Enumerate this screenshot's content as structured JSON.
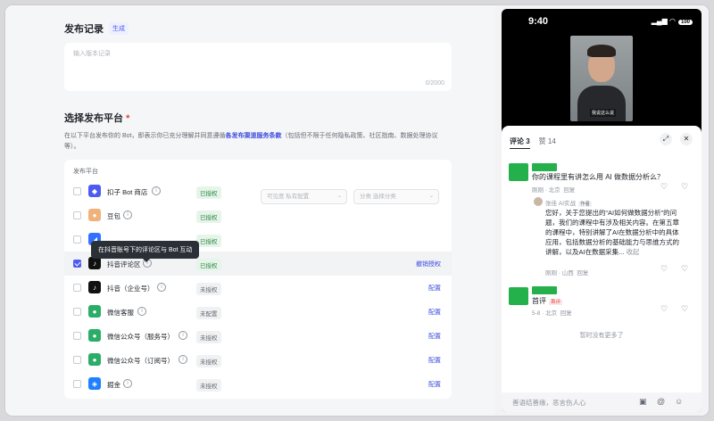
{
  "publish": {
    "notes_title": "发布记录",
    "generate_label": "生成",
    "notes_placeholder": "输入版本记录",
    "notes_counter": "0/2000",
    "platform_title": "选择发布平台",
    "required_mark": "*",
    "desc_prefix": "在以下平台发布你的 Bot，即表示你已充分理解并同意遵循",
    "desc_link": "各发布渠道服务条款",
    "desc_suffix": "（包括但不限于任何隐私政策、社区指南、数据处理协议等）。",
    "table_header": "发布平台",
    "visibility_select": "可见度  私有配置",
    "category_select": "分类  选择分类",
    "tooltip": "在抖音账号下的评论区与 Bot 互动",
    "rows": [
      {
        "name": "扣子 Bot 商店",
        "status": "已授权",
        "status_type": "ok",
        "action": "",
        "checked": false,
        "icon": "coze-store-icon",
        "icon_color": "#4e5bf2",
        "icon_glyph": "◆"
      },
      {
        "name": "豆包",
        "status": "已授权",
        "status_type": "ok",
        "action": "",
        "checked": false,
        "icon": "doubao-icon",
        "icon_color": "#f0b27a",
        "icon_glyph": "●"
      },
      {
        "name": "",
        "status": "已授权",
        "status_type": "ok",
        "action": "",
        "checked": false,
        "icon": "feishu-icon",
        "icon_color": "#3370ff",
        "icon_glyph": "◢"
      },
      {
        "name": "抖音评论区",
        "status": "已授权",
        "status_type": "ok",
        "action": "撤销授权",
        "checked": true,
        "icon": "douyin-icon",
        "icon_color": "#111111",
        "icon_glyph": "♪"
      },
      {
        "name": "抖音（企业号）",
        "status": "未授权",
        "status_type": "no",
        "action": "配置",
        "checked": false,
        "icon": "douyin-icon",
        "icon_color": "#111111",
        "icon_glyph": "♪"
      },
      {
        "name": "微信客服",
        "status": "未配置",
        "status_type": "no",
        "action": "配置",
        "checked": false,
        "icon": "wechat-icon",
        "icon_color": "#2aae67",
        "icon_glyph": "●"
      },
      {
        "name": "微信公众号（服务号）",
        "status": "未授权",
        "status_type": "no",
        "action": "配置",
        "checked": false,
        "icon": "wechat-icon",
        "icon_color": "#2aae67",
        "icon_glyph": "●"
      },
      {
        "name": "微信公众号（订阅号）",
        "status": "未授权",
        "status_type": "no",
        "action": "配置",
        "checked": false,
        "icon": "wechat-icon",
        "icon_color": "#2aae67",
        "icon_glyph": "●"
      },
      {
        "name": "掘金",
        "status": "未授权",
        "status_type": "no",
        "action": "配置",
        "checked": false,
        "icon": "juejin-icon",
        "icon_color": "#1e80ff",
        "icon_glyph": "◈"
      }
    ]
  },
  "phone": {
    "time": "9:40",
    "battery": "100",
    "video_caption": "我说这么说",
    "comments_tab": "评论 3",
    "likes_tab": "赞 14",
    "comment1_text": "你的课程里有讲怎么用 AI 做数据分析么？",
    "comment1_meta": "刚刚 · 北京",
    "reply_label": "回复",
    "reply_author": "张佳 AI实战",
    "author_tag": "作者",
    "reply_text": "您好，关于您提出的“AI如何做数据分析”的问题，我们的课程中有涉及相关内容。在第五章的课程中，特别讲解了AI在数据分析中的具体应用，包括数据分析的基础能力与思维方式的讲解，以及AI在数据采集...",
    "reply_more": "收起",
    "reply_meta": "刚刚 · 山西",
    "comment2_text": "首评",
    "first_tag": "首评",
    "comment2_meta": "5-8 · 北京",
    "no_more": "暂时没有更多了",
    "input_placeholder": "善语结善缘，恶言伤人心"
  },
  "colors": {
    "accent": "#4e5bf2",
    "link": "#3b4bde",
    "ok": "#2e8b45",
    "douyin_green": "#24b14b"
  }
}
